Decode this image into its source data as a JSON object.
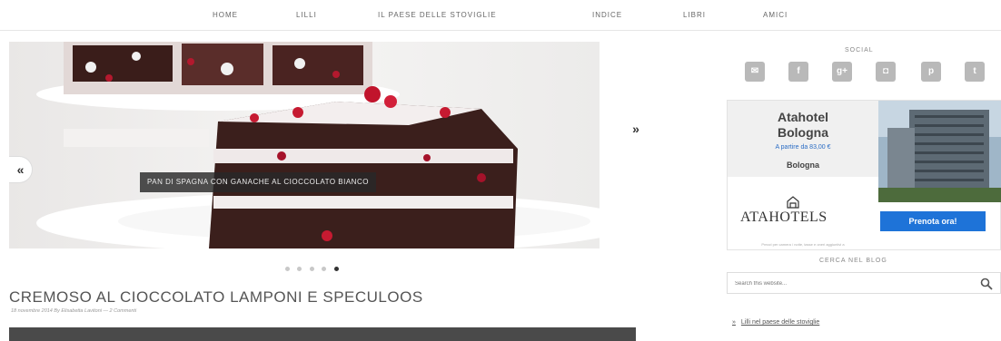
{
  "nav": {
    "items": [
      {
        "label": "HOME"
      },
      {
        "label": "LILLI"
      },
      {
        "label": "IL PAESE DELLE STOVIGLIE"
      },
      {
        "label": "INDICE"
      },
      {
        "label": "LIBRI"
      },
      {
        "label": "AMICI"
      }
    ]
  },
  "slider": {
    "caption": "PAN DI SPAGNA CON GANACHE AL CIOCCOLATO BIANCO",
    "prev_icon": "chevron-left-icon",
    "prev_label": "«",
    "next_icon": "chevron-right-icon",
    "next_label": "»",
    "dots_total": 5,
    "active_dot": 5
  },
  "post": {
    "title": "CREMOSO AL CIOCCOLATO LAMPONI E SPECULOOS",
    "meta": "18 novembre 2014 By Elisabetta Lavitoni — 2 Commenti"
  },
  "sidebar": {
    "social_heading": "SOCIAL",
    "social_buttons": [
      {
        "icon": "mail-icon",
        "glyph": "✉"
      },
      {
        "icon": "facebook-icon",
        "glyph": "f"
      },
      {
        "icon": "google-plus-icon",
        "glyph": "g+"
      },
      {
        "icon": "instagram-icon",
        "glyph": "◘"
      },
      {
        "icon": "pinterest-icon",
        "glyph": "p"
      },
      {
        "icon": "twitter-icon",
        "glyph": "t"
      }
    ],
    "ad": {
      "hotel_name_line1": "Atahotel",
      "hotel_name_line2": "Bologna",
      "price": "A partire da 83,00 €",
      "city": "Bologna",
      "brand": "ATAHOTELS",
      "cta": "Prenota ora!",
      "fine_print": "Prezzi per camera / notte, tasse e oneri aggiuntivi a"
    },
    "search_heading": "CERCA NEL BLOG",
    "search_placeholder": "Search this website...",
    "link": "Lilli nel paese delle stoviglie",
    "link_bullet": "»",
    "colors": {
      "cta": "#1e73d8",
      "social": "#b9b9b9",
      "accent_price": "#2a6cc4"
    }
  }
}
